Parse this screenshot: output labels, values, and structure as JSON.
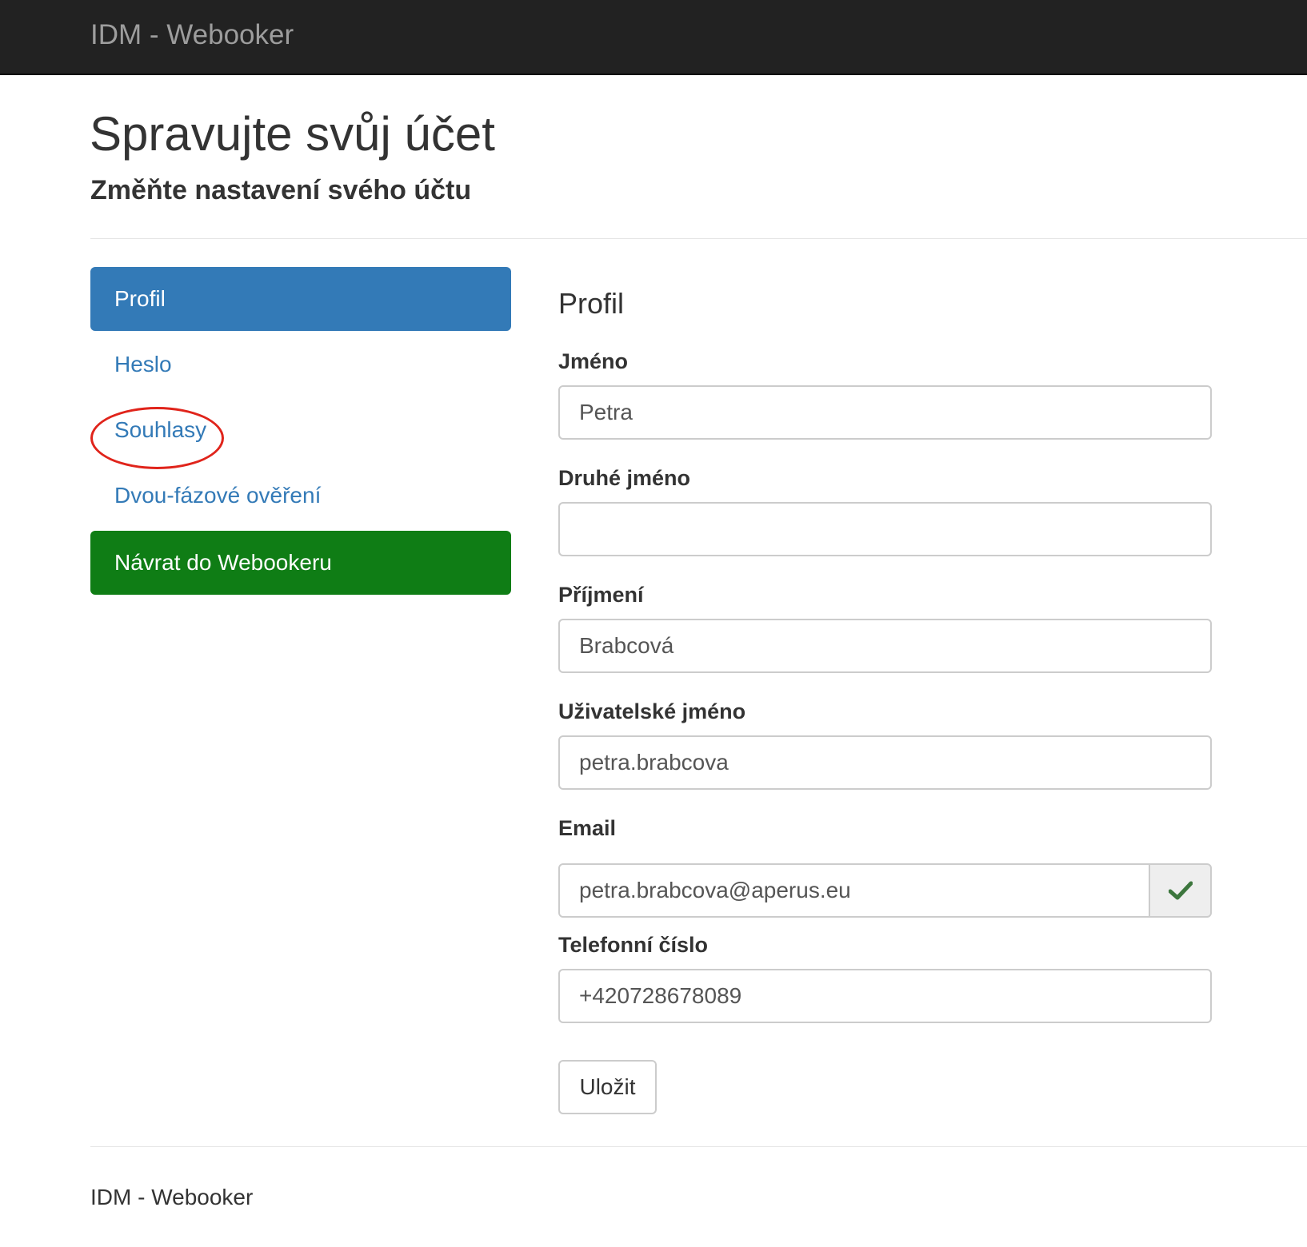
{
  "navbar": {
    "brand": "IDM - Webooker"
  },
  "header": {
    "title": "Spravujte svůj účet",
    "subtitle": "Změňte nastavení svého účtu"
  },
  "sidebar": {
    "items": [
      {
        "label": "Profil",
        "state": "active"
      },
      {
        "label": "Heslo"
      },
      {
        "label": "Souhlasy",
        "highlighted": true
      },
      {
        "label": "Dvou-fázové ověření"
      },
      {
        "label": "Návrat do Webookeru",
        "state": "success"
      }
    ]
  },
  "form": {
    "title": "Profil",
    "fields": {
      "first_name": {
        "label": "Jméno",
        "value": "Petra"
      },
      "middle_name": {
        "label": "Druhé jméno",
        "value": ""
      },
      "last_name": {
        "label": "Příjmení",
        "value": "Brabcová"
      },
      "username": {
        "label": "Uživatelské jméno",
        "value": "petra.brabcova"
      },
      "email": {
        "label": "Email",
        "value": "petra.brabcova@aperus.eu",
        "verified_icon": "check-icon"
      },
      "phone": {
        "label": "Telefonní číslo",
        "value": "+420728678089"
      }
    },
    "save_label": "Uložit"
  },
  "footer": {
    "text": "IDM - Webooker"
  },
  "colors": {
    "navbar_bg": "#222222",
    "brand_text": "#9d9d9d",
    "primary": "#337ab7",
    "success": "#0f7d15",
    "highlight_circle": "#e0241b",
    "check": "#3c763d"
  }
}
